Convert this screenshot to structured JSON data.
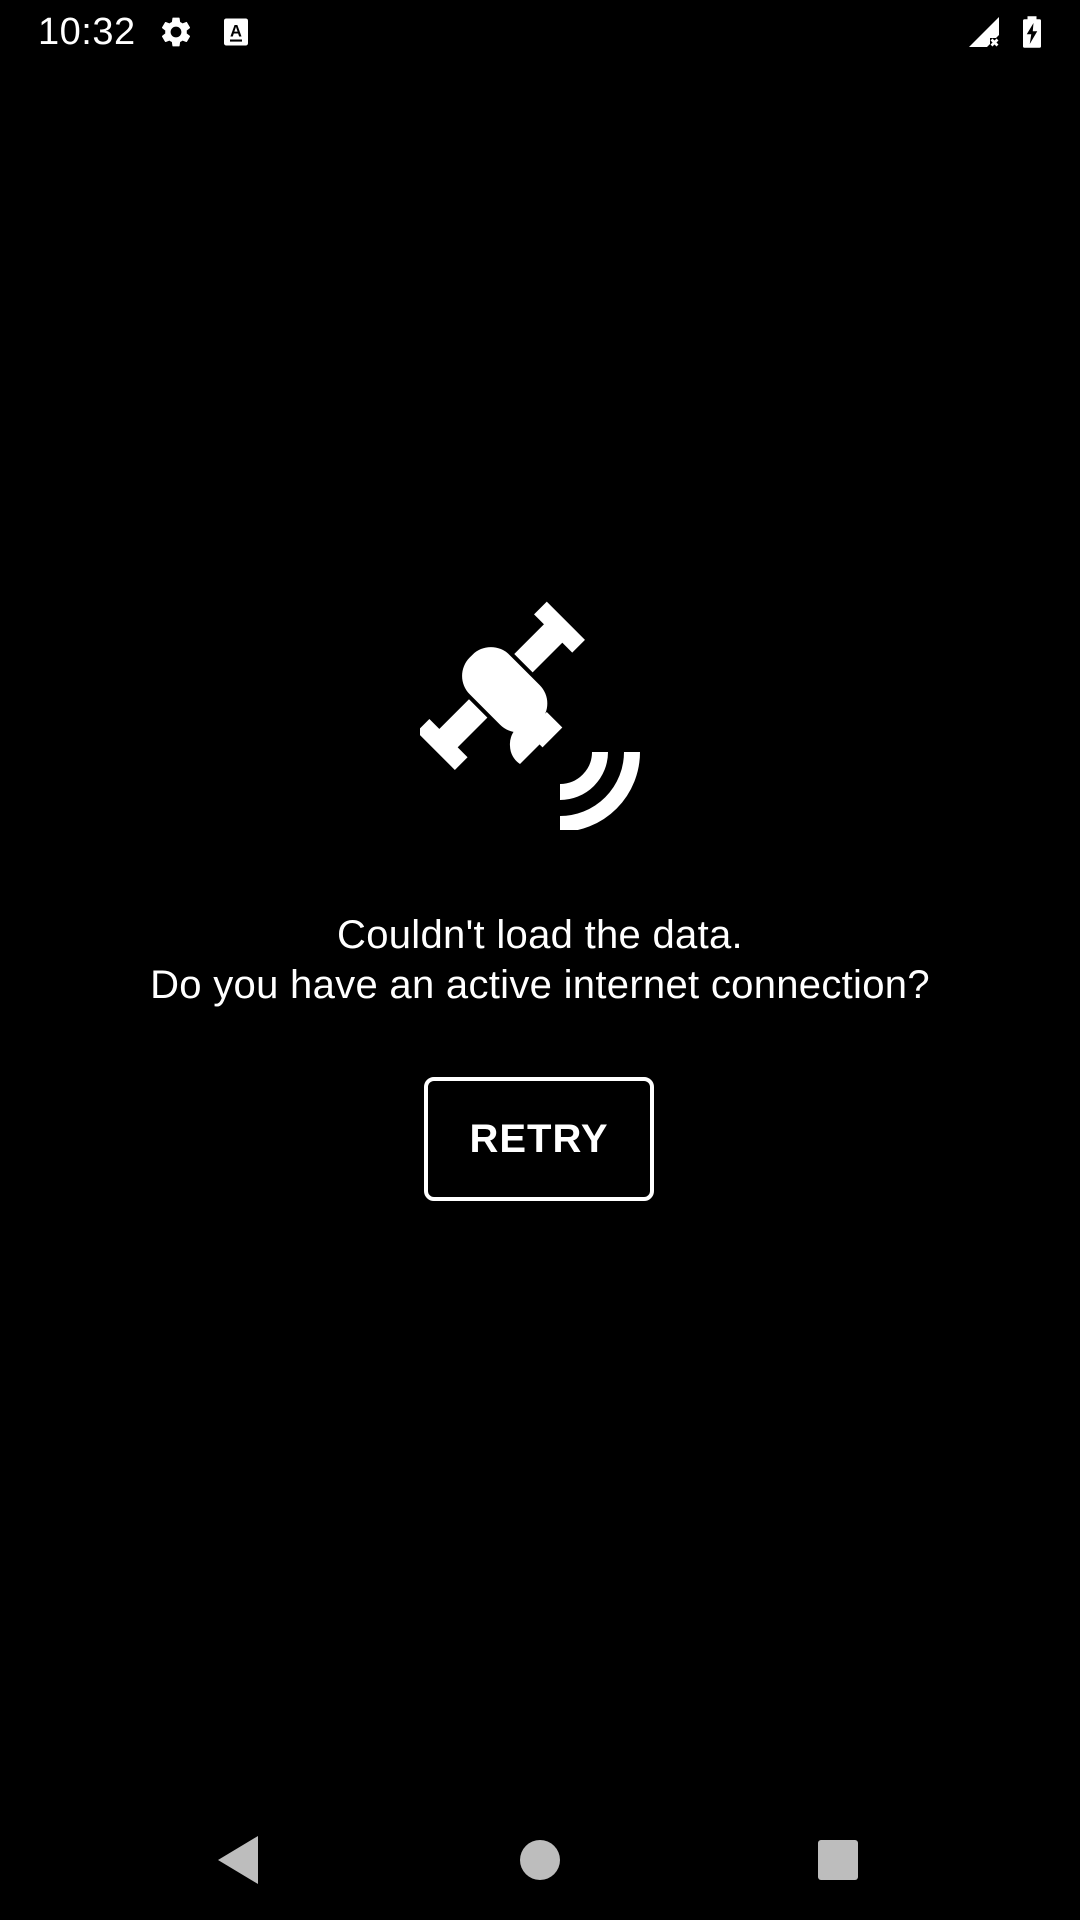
{
  "status_bar": {
    "time": "10:32",
    "icons": {
      "settings": "gear-icon",
      "keyboard": "keyboard-a-icon",
      "signal": "cell-signal-no-data-icon",
      "battery": "battery-charging-icon"
    }
  },
  "error": {
    "icon": "satellite-no-signal-icon",
    "line1": "Couldn't load the data.",
    "line2": "Do you have an active internet connection?"
  },
  "retry_button": {
    "label": "RETRY"
  },
  "nav_bar": {
    "back": "back-triangle-icon",
    "home": "home-circle-icon",
    "recents": "recents-square-icon"
  },
  "colors": {
    "background": "#000000",
    "foreground": "#ffffff",
    "nav_icon": "#bdbdbd"
  }
}
